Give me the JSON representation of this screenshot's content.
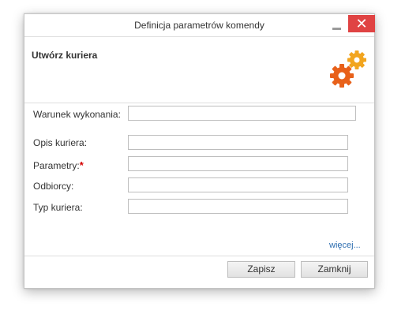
{
  "window": {
    "title": "Definicja parametrów komendy",
    "close_glyph": "✕",
    "minimize_icon": "minimize-icon"
  },
  "header": {
    "title": "Utwórz kuriera",
    "icon": "gears-icon",
    "gear_colors": {
      "large": "#e8611a",
      "small": "#f2a51e"
    }
  },
  "form": {
    "condition_label": "Warunek wykonania:",
    "condition_value": "",
    "description_label": "Opis kuriera:",
    "description_value": "",
    "parameters_label": "Parametry:",
    "parameters_required_mark": "*",
    "parameters_value": "",
    "recipients_label": "Odbiorcy:",
    "recipients_value": "",
    "type_label": "Typ kuriera:",
    "type_value": ""
  },
  "more_link": "więcej...",
  "footer": {
    "save_label": "Zapisz",
    "close_label": "Zamknij"
  },
  "colors": {
    "close_button": "#e04343",
    "link": "#2c6db0",
    "required": "#d40000"
  }
}
